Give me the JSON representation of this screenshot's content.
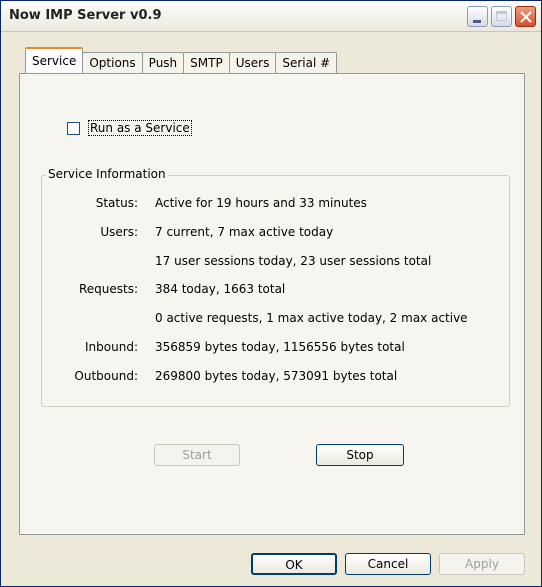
{
  "window": {
    "title": "Now IMP Server v0.9"
  },
  "tabs": [
    {
      "label": "Service",
      "active": true
    },
    {
      "label": "Options"
    },
    {
      "label": "Push"
    },
    {
      "label": "SMTP"
    },
    {
      "label": "Users"
    },
    {
      "label": "Serial #"
    }
  ],
  "service": {
    "run_as_service": {
      "label": "Run as a Service",
      "checked": false
    },
    "group_title": "Service Information",
    "rows": [
      {
        "label": "Status:",
        "value": "Active for 19 hours and 33 minutes"
      },
      {
        "label": "Users:",
        "value": "7 current, 7 max active today"
      },
      {
        "label": "",
        "value": "17 user sessions today, 23 user sessions total"
      },
      {
        "label": "Requests:",
        "value": "384 today, 1663 total"
      },
      {
        "label": "",
        "value": "0 active requests, 1 max active today, 2 max active"
      },
      {
        "label": "Inbound:",
        "value": "356859 bytes today, 1156556 bytes total"
      },
      {
        "label": "Outbound:",
        "value": "269800 bytes today, 573091 bytes total"
      }
    ],
    "start_label": "Start",
    "stop_label": "Stop"
  },
  "footer": {
    "ok": "OK",
    "cancel": "Cancel",
    "apply": "Apply"
  }
}
